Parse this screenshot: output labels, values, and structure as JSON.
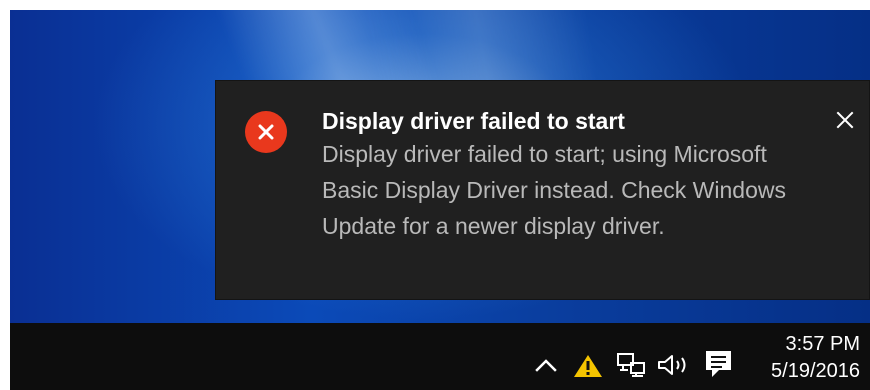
{
  "notification": {
    "title": "Display driver failed to start",
    "body": "Display driver failed to start; using Microsoft Basic Display Driver instead. Check Windows Update for a newer display driver.",
    "icon": "error-icon",
    "close_icon": "close-icon"
  },
  "taskbar": {
    "tray_icons": [
      "chevron-up-icon",
      "warning-icon",
      "network-icon",
      "volume-icon",
      "action-center-icon"
    ],
    "time": "3:57 PM",
    "date": "5/19/2016"
  },
  "colors": {
    "desktop_blue": "#0b4ab8",
    "toast_background": "#202020",
    "error_red": "#e9381d",
    "warning_yellow": "#f4c400",
    "taskbar": "#0d0d0d"
  }
}
